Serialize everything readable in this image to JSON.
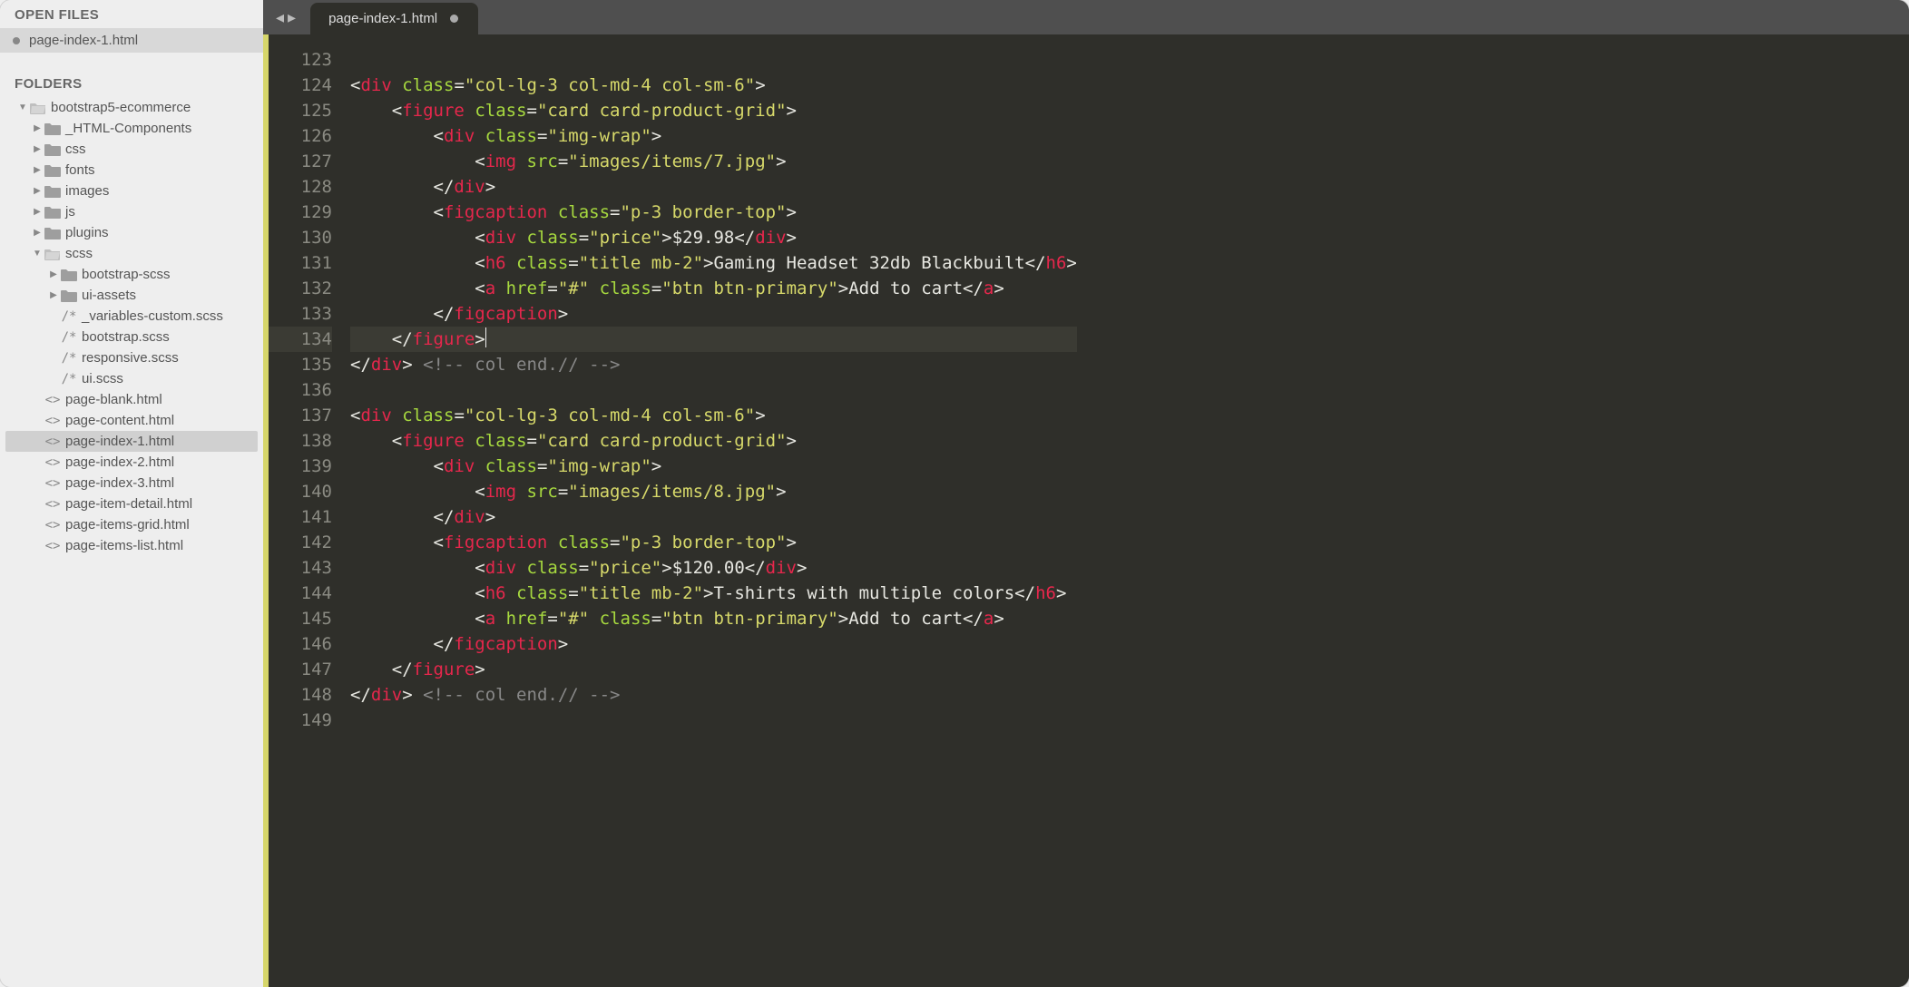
{
  "sidebar": {
    "open_files_title": "OPEN FILES",
    "open_files": [
      "page-index-1.html"
    ],
    "folders_title": "FOLDERS",
    "tree": [
      {
        "depth": 0,
        "icon": "folder-open",
        "label": "bootstrap5-ecommerce",
        "arrow": "down"
      },
      {
        "depth": 1,
        "icon": "folder",
        "label": "_HTML-Components",
        "arrow": "right"
      },
      {
        "depth": 1,
        "icon": "folder",
        "label": "css",
        "arrow": "right"
      },
      {
        "depth": 1,
        "icon": "folder",
        "label": "fonts",
        "arrow": "right"
      },
      {
        "depth": 1,
        "icon": "folder",
        "label": "images",
        "arrow": "right"
      },
      {
        "depth": 1,
        "icon": "folder",
        "label": "js",
        "arrow": "right"
      },
      {
        "depth": 1,
        "icon": "folder",
        "label": "plugins",
        "arrow": "right"
      },
      {
        "depth": 1,
        "icon": "folder-open",
        "label": "scss",
        "arrow": "down"
      },
      {
        "depth": 2,
        "icon": "folder",
        "label": "bootstrap-scss",
        "arrow": "right"
      },
      {
        "depth": 2,
        "icon": "folder",
        "label": "ui-assets",
        "arrow": "right"
      },
      {
        "depth": 2,
        "icon": "scss",
        "label": "_variables-custom.scss"
      },
      {
        "depth": 2,
        "icon": "scss",
        "label": "bootstrap.scss"
      },
      {
        "depth": 2,
        "icon": "scss",
        "label": "responsive.scss"
      },
      {
        "depth": 2,
        "icon": "scss",
        "label": "ui.scss"
      },
      {
        "depth": 1,
        "icon": "html",
        "label": "page-blank.html"
      },
      {
        "depth": 1,
        "icon": "html",
        "label": "page-content.html"
      },
      {
        "depth": 1,
        "icon": "html",
        "label": "page-index-1.html",
        "selected": true
      },
      {
        "depth": 1,
        "icon": "html",
        "label": "page-index-2.html"
      },
      {
        "depth": 1,
        "icon": "html",
        "label": "page-index-3.html"
      },
      {
        "depth": 1,
        "icon": "html",
        "label": "page-item-detail.html"
      },
      {
        "depth": 1,
        "icon": "html",
        "label": "page-items-grid.html"
      },
      {
        "depth": 1,
        "icon": "html",
        "label": "page-items-list.html"
      }
    ]
  },
  "editor": {
    "tab_title": "page-index-1.html",
    "modified": true,
    "first_line": 123,
    "current_line": 134,
    "lines": [
      {
        "n": 123,
        "tokens": []
      },
      {
        "n": 124,
        "tokens": [
          {
            "t": "w",
            "v": "<"
          },
          {
            "t": "tag",
            "v": "div"
          },
          {
            "t": "w",
            "v": " "
          },
          {
            "t": "attr",
            "v": "class"
          },
          {
            "t": "w",
            "v": "="
          },
          {
            "t": "str",
            "v": "\"col-lg-3 col-md-4 col-sm-6\""
          },
          {
            "t": "w",
            "v": ">"
          }
        ],
        "ind": 0
      },
      {
        "n": 125,
        "tokens": [
          {
            "t": "w",
            "v": "<"
          },
          {
            "t": "tag",
            "v": "figure"
          },
          {
            "t": "w",
            "v": " "
          },
          {
            "t": "attr",
            "v": "class"
          },
          {
            "t": "w",
            "v": "="
          },
          {
            "t": "str",
            "v": "\"card card-product-grid\""
          },
          {
            "t": "w",
            "v": ">"
          }
        ],
        "ind": 1
      },
      {
        "n": 126,
        "tokens": [
          {
            "t": "w",
            "v": "<"
          },
          {
            "t": "tag",
            "v": "div"
          },
          {
            "t": "w",
            "v": " "
          },
          {
            "t": "attr",
            "v": "class"
          },
          {
            "t": "w",
            "v": "="
          },
          {
            "t": "str",
            "v": "\"img-wrap\""
          },
          {
            "t": "w",
            "v": ">"
          }
        ],
        "ind": 2
      },
      {
        "n": 127,
        "tokens": [
          {
            "t": "w",
            "v": "<"
          },
          {
            "t": "tag",
            "v": "img"
          },
          {
            "t": "w",
            "v": " "
          },
          {
            "t": "attr",
            "v": "src"
          },
          {
            "t": "w",
            "v": "="
          },
          {
            "t": "str",
            "v": "\"images/items/7.jpg\""
          },
          {
            "t": "w",
            "v": ">"
          }
        ],
        "ind": 3
      },
      {
        "n": 128,
        "tokens": [
          {
            "t": "w",
            "v": "</"
          },
          {
            "t": "tag",
            "v": "div"
          },
          {
            "t": "w",
            "v": ">"
          }
        ],
        "ind": 2
      },
      {
        "n": 129,
        "tokens": [
          {
            "t": "w",
            "v": "<"
          },
          {
            "t": "tag",
            "v": "figcaption"
          },
          {
            "t": "w",
            "v": " "
          },
          {
            "t": "attr",
            "v": "class"
          },
          {
            "t": "w",
            "v": "="
          },
          {
            "t": "str",
            "v": "\"p-3 border-top\""
          },
          {
            "t": "w",
            "v": ">"
          }
        ],
        "ind": 2
      },
      {
        "n": 130,
        "tokens": [
          {
            "t": "w",
            "v": "<"
          },
          {
            "t": "tag",
            "v": "div"
          },
          {
            "t": "w",
            "v": " "
          },
          {
            "t": "attr",
            "v": "class"
          },
          {
            "t": "w",
            "v": "="
          },
          {
            "t": "str",
            "v": "\"price\""
          },
          {
            "t": "w",
            "v": ">$29.98</"
          },
          {
            "t": "tag",
            "v": "div"
          },
          {
            "t": "w",
            "v": ">"
          }
        ],
        "ind": 3
      },
      {
        "n": 131,
        "tokens": [
          {
            "t": "w",
            "v": "<"
          },
          {
            "t": "tag",
            "v": "h6"
          },
          {
            "t": "w",
            "v": " "
          },
          {
            "t": "attr",
            "v": "class"
          },
          {
            "t": "w",
            "v": "="
          },
          {
            "t": "str",
            "v": "\"title mb-2\""
          },
          {
            "t": "w",
            "v": ">Gaming Headset 32db Blackbuilt</"
          },
          {
            "t": "tag",
            "v": "h6"
          },
          {
            "t": "w",
            "v": ">"
          }
        ],
        "ind": 3
      },
      {
        "n": 132,
        "tokens": [
          {
            "t": "w",
            "v": "<"
          },
          {
            "t": "tag",
            "v": "a"
          },
          {
            "t": "w",
            "v": " "
          },
          {
            "t": "attr",
            "v": "href"
          },
          {
            "t": "w",
            "v": "="
          },
          {
            "t": "str",
            "v": "\"#\""
          },
          {
            "t": "w",
            "v": " "
          },
          {
            "t": "attr",
            "v": "class"
          },
          {
            "t": "w",
            "v": "="
          },
          {
            "t": "str",
            "v": "\"btn btn-primary\""
          },
          {
            "t": "w",
            "v": ">Add to cart</"
          },
          {
            "t": "tag",
            "v": "a"
          },
          {
            "t": "w",
            "v": ">"
          }
        ],
        "ind": 3
      },
      {
        "n": 133,
        "tokens": [
          {
            "t": "w",
            "v": "</"
          },
          {
            "t": "tag",
            "v": "figcaption"
          },
          {
            "t": "w",
            "v": ">"
          }
        ],
        "ind": 2
      },
      {
        "n": 134,
        "tokens": [
          {
            "t": "w",
            "v": "</"
          },
          {
            "t": "tag",
            "v": "figure"
          },
          {
            "t": "w",
            "v": ">"
          },
          {
            "t": "cursor",
            "v": ""
          }
        ],
        "ind": 1
      },
      {
        "n": 135,
        "tokens": [
          {
            "t": "w",
            "v": "</"
          },
          {
            "t": "tag",
            "v": "div"
          },
          {
            "t": "w",
            "v": "> "
          },
          {
            "t": "cm",
            "v": "<!-- col end.// -->"
          }
        ],
        "ind": 0
      },
      {
        "n": 136,
        "tokens": []
      },
      {
        "n": 137,
        "tokens": [
          {
            "t": "w",
            "v": "<"
          },
          {
            "t": "tag",
            "v": "div"
          },
          {
            "t": "w",
            "v": " "
          },
          {
            "t": "attr",
            "v": "class"
          },
          {
            "t": "w",
            "v": "="
          },
          {
            "t": "str",
            "v": "\"col-lg-3 col-md-4 col-sm-6\""
          },
          {
            "t": "w",
            "v": ">"
          }
        ],
        "ind": 0
      },
      {
        "n": 138,
        "tokens": [
          {
            "t": "w",
            "v": "<"
          },
          {
            "t": "tag",
            "v": "figure"
          },
          {
            "t": "w",
            "v": " "
          },
          {
            "t": "attr",
            "v": "class"
          },
          {
            "t": "w",
            "v": "="
          },
          {
            "t": "str",
            "v": "\"card card-product-grid\""
          },
          {
            "t": "w",
            "v": ">"
          }
        ],
        "ind": 1
      },
      {
        "n": 139,
        "tokens": [
          {
            "t": "w",
            "v": "<"
          },
          {
            "t": "tag",
            "v": "div"
          },
          {
            "t": "w",
            "v": " "
          },
          {
            "t": "attr",
            "v": "class"
          },
          {
            "t": "w",
            "v": "="
          },
          {
            "t": "str",
            "v": "\"img-wrap\""
          },
          {
            "t": "w",
            "v": ">"
          }
        ],
        "ind": 2
      },
      {
        "n": 140,
        "tokens": [
          {
            "t": "w",
            "v": "<"
          },
          {
            "t": "tag",
            "v": "img"
          },
          {
            "t": "w",
            "v": " "
          },
          {
            "t": "attr",
            "v": "src"
          },
          {
            "t": "w",
            "v": "="
          },
          {
            "t": "str",
            "v": "\"images/items/8.jpg\""
          },
          {
            "t": "w",
            "v": ">"
          }
        ],
        "ind": 3
      },
      {
        "n": 141,
        "tokens": [
          {
            "t": "w",
            "v": "</"
          },
          {
            "t": "tag",
            "v": "div"
          },
          {
            "t": "w",
            "v": ">"
          }
        ],
        "ind": 2
      },
      {
        "n": 142,
        "tokens": [
          {
            "t": "w",
            "v": "<"
          },
          {
            "t": "tag",
            "v": "figcaption"
          },
          {
            "t": "w",
            "v": " "
          },
          {
            "t": "attr",
            "v": "class"
          },
          {
            "t": "w",
            "v": "="
          },
          {
            "t": "str",
            "v": "\"p-3 border-top\""
          },
          {
            "t": "w",
            "v": ">"
          }
        ],
        "ind": 2
      },
      {
        "n": 143,
        "tokens": [
          {
            "t": "w",
            "v": "<"
          },
          {
            "t": "tag",
            "v": "div"
          },
          {
            "t": "w",
            "v": " "
          },
          {
            "t": "attr",
            "v": "class"
          },
          {
            "t": "w",
            "v": "="
          },
          {
            "t": "str",
            "v": "\"price\""
          },
          {
            "t": "w",
            "v": ">$120.00</"
          },
          {
            "t": "tag",
            "v": "div"
          },
          {
            "t": "w",
            "v": ">"
          }
        ],
        "ind": 3
      },
      {
        "n": 144,
        "tokens": [
          {
            "t": "w",
            "v": "<"
          },
          {
            "t": "tag",
            "v": "h6"
          },
          {
            "t": "w",
            "v": " "
          },
          {
            "t": "attr",
            "v": "class"
          },
          {
            "t": "w",
            "v": "="
          },
          {
            "t": "str",
            "v": "\"title mb-2\""
          },
          {
            "t": "w",
            "v": ">T-shirts with multiple colors</"
          },
          {
            "t": "tag",
            "v": "h6"
          },
          {
            "t": "w",
            "v": ">"
          }
        ],
        "ind": 3
      },
      {
        "n": 145,
        "tokens": [
          {
            "t": "w",
            "v": "<"
          },
          {
            "t": "tag",
            "v": "a"
          },
          {
            "t": "w",
            "v": " "
          },
          {
            "t": "attr",
            "v": "href"
          },
          {
            "t": "w",
            "v": "="
          },
          {
            "t": "str",
            "v": "\"#\""
          },
          {
            "t": "w",
            "v": " "
          },
          {
            "t": "attr",
            "v": "class"
          },
          {
            "t": "w",
            "v": "="
          },
          {
            "t": "str",
            "v": "\"btn btn-primary\""
          },
          {
            "t": "w",
            "v": ">Add to cart</"
          },
          {
            "t": "tag",
            "v": "a"
          },
          {
            "t": "w",
            "v": ">"
          }
        ],
        "ind": 3
      },
      {
        "n": 146,
        "tokens": [
          {
            "t": "w",
            "v": "</"
          },
          {
            "t": "tag",
            "v": "figcaption"
          },
          {
            "t": "w",
            "v": ">"
          }
        ],
        "ind": 2
      },
      {
        "n": 147,
        "tokens": [
          {
            "t": "w",
            "v": "</"
          },
          {
            "t": "tag",
            "v": "figure"
          },
          {
            "t": "w",
            "v": ">"
          }
        ],
        "ind": 1
      },
      {
        "n": 148,
        "tokens": [
          {
            "t": "w",
            "v": "</"
          },
          {
            "t": "tag",
            "v": "div"
          },
          {
            "t": "w",
            "v": "> "
          },
          {
            "t": "cm",
            "v": "<!-- col end.// -->"
          }
        ],
        "ind": 0
      },
      {
        "n": 149,
        "tokens": []
      }
    ]
  }
}
